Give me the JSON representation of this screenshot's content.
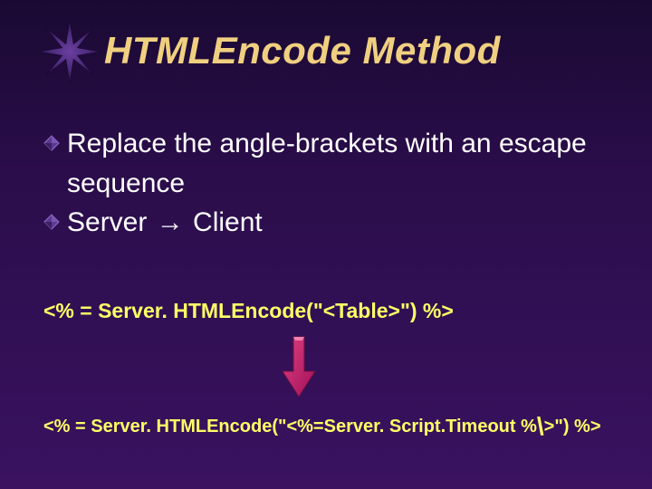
{
  "title": "HTMLEncode Method",
  "bullets": {
    "b1_lead": "Replace",
    "b1_rest": " the angle-brackets with an escape",
    "b1_cont": "sequence",
    "b2_lead": "Server ",
    "b2_arrow": "→",
    "b2_rest": " Client"
  },
  "code": {
    "line1": "<% = Server. HTMLEncode(\"<Table>\") %>",
    "line2a": "<% = Server. HTMLEncode(\"<%=Server. Script.Timeout %",
    "line2_slash": "\\",
    "line2b": ">\") %>"
  }
}
